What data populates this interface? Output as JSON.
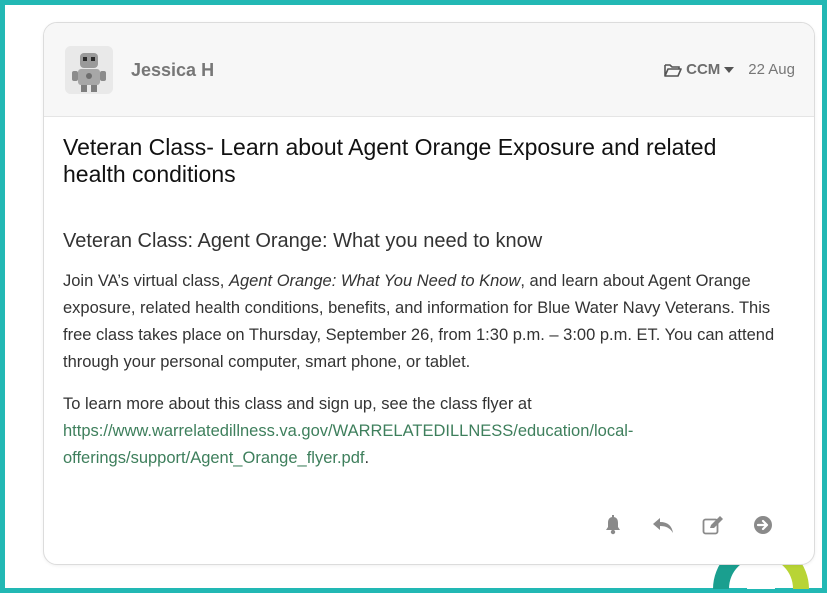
{
  "post": {
    "author": "Jessica H",
    "group": "CCM",
    "date": "22 Aug",
    "title": "Veteran Class- Learn about Agent Orange Exposure and related health conditions",
    "subtitle": "Veteran Class: Agent Orange: What you need to know",
    "body1_before": "Join VA’s virtual class, ",
    "body1_italic": "Agent Orange: What You Need to Know",
    "body1_after": ", and learn about Agent Orange exposure, related health conditions, benefits, and information for Blue Water Navy Veterans. This free class takes place on Thursday, September 26, from 1:30 p.m. – 3:00 p.m. ET. You can attend through your personal computer, smart phone, or tablet.",
    "body2_before": " To learn more about this class and sign up, see the class flyer at ",
    "link_text": "https://www.warrelatedillness.va.gov/WARRELATEDILLNESS/education/local-offerings/support/Agent_Orange_flyer.pdf",
    "body2_after": "."
  },
  "icons": {
    "group": "folder-open-icon",
    "dropdown": "caret-down-icon",
    "notify": "bell-icon",
    "reply": "reply-icon",
    "edit": "edit-icon",
    "forward": "arrow-circle-right-icon"
  },
  "colors": {
    "frame": "#22b8b4",
    "link": "#3e7f5c",
    "icon": "#8a8a8a"
  }
}
